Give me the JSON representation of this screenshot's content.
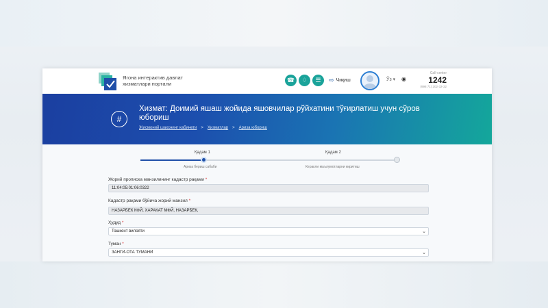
{
  "header": {
    "logo_text": "Ягона интерактив давлат хизматлари портали",
    "exit_label": "Чиқиш",
    "lang_label": "Ўз",
    "call_center_label": "Call-center",
    "call_center_number": "1242",
    "call_center_phone": "(998 71) 202-32-32",
    "accent_color": "#1aa39a"
  },
  "banner": {
    "title": "Хизмат: Доимий яшаш жойида яшовчилар рўйхатини тўғирлатиш учун сўров юбориш",
    "breadcrumbs": [
      "Жисмоний шахснинг кабинети",
      "Хизматлар",
      "Ариза юбориш"
    ]
  },
  "stages": [
    {
      "label": "Қадам 1",
      "sub": "Ариза бериш сабаби"
    },
    {
      "label": "Қадам 2",
      "sub": "Керакли маълумотларни киритиш"
    }
  ],
  "progress": 0.25,
  "form": {
    "fields": [
      {
        "label": "Жорий прописка манзилининг кадастр рақами",
        "value": "11:04:05:01:06:0322",
        "type": "readonly"
      },
      {
        "label": "Кадастр рақами бўйича жорий манзил",
        "value": "НАЗАРБЕК КФЙ, ХАРАКАТ МФЙ, НАЗАРБЕК,",
        "type": "readonly"
      },
      {
        "label": "Ҳудуд",
        "value": "Тошкент вилояти",
        "type": "select"
      },
      {
        "label": "Туман",
        "value": "ЗАНГИ-ОТА ТУМАНИ",
        "type": "select"
      }
    ]
  }
}
